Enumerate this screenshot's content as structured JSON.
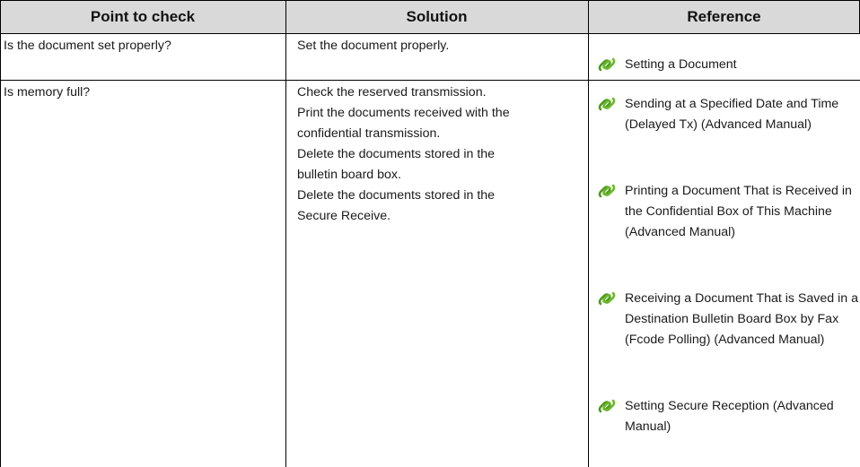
{
  "headers": {
    "point": "Point to check",
    "solution": "Solution",
    "reference": "Reference"
  },
  "rows": [
    {
      "point": "Is the document set properly?",
      "solution": [
        "Set the document properly."
      ],
      "references": [
        "Setting a Document"
      ]
    },
    {
      "point": "Is memory full?",
      "solution": [
        "Check the reserved transmission.",
        "Print the documents received with the",
        "confidential transmission.",
        "Delete the documents stored in the",
        "bulletin board box.",
        "Delete the documents stored in the",
        "Secure Receive."
      ],
      "references": [
        "Sending at a Specified Date and Time (Delayed Tx) (Advanced Manual)",
        "Printing a Document That is Received in the Confidential Box of This Machine (Advanced Manual)",
        "Receiving a Document That is Saved in a Destination Bulletin Board Box by Fax (Fcode Polling) (Advanced Manual)",
        "Setting Secure Reception (Advanced Manual)"
      ]
    }
  ],
  "icons": {
    "reference_link": "link-chain-icon"
  },
  "colors": {
    "header_bg": "#d9d9d9",
    "icon_green": "#4f9a1e"
  }
}
